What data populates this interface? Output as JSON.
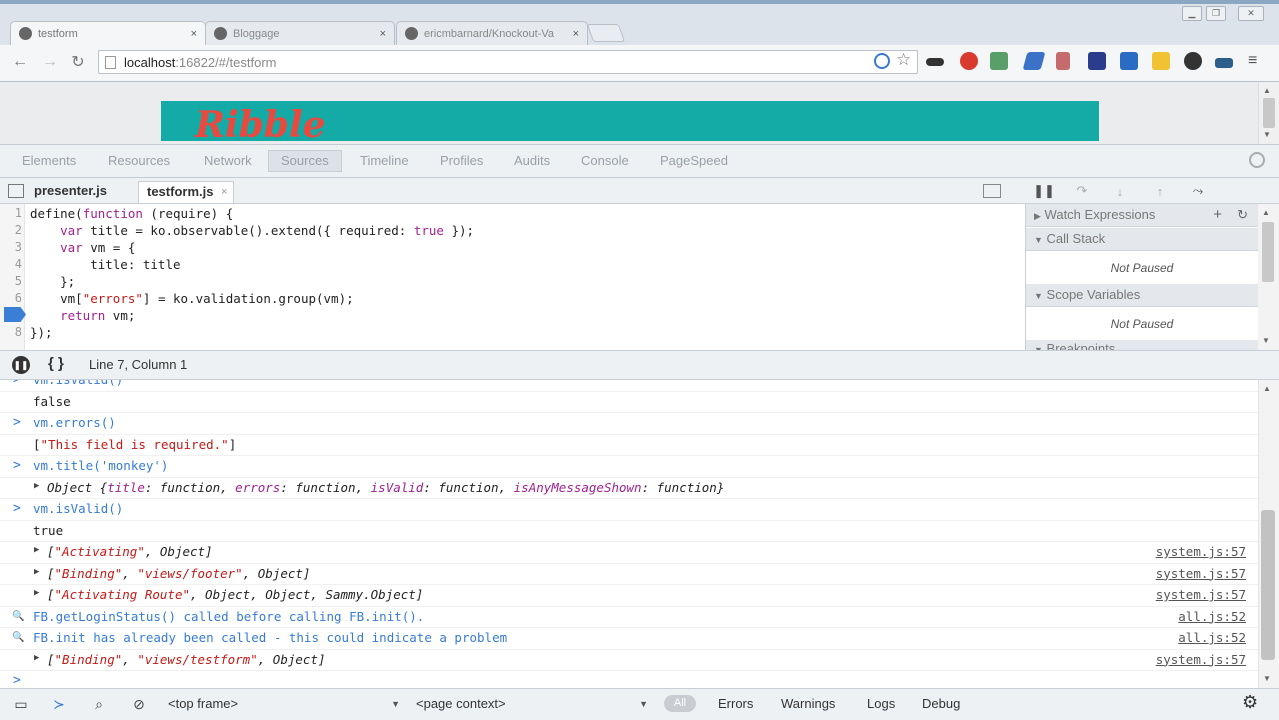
{
  "browser": {
    "tabs": [
      {
        "label": "testform",
        "close": "×"
      },
      {
        "label": "Bloggage",
        "close": "×"
      },
      {
        "label": "ericmbarnard/Knockout-Va",
        "close": "×"
      }
    ],
    "address": {
      "host": "localhost",
      "rest": ":16822/#/testform"
    }
  },
  "page": {
    "logo": "Ribble"
  },
  "devtools": {
    "tabs": [
      "Elements",
      "Resources",
      "Network",
      "Sources",
      "Timeline",
      "Profiles",
      "Audits",
      "Console",
      "PageSpeed"
    ],
    "file_tabs": [
      "presenter.js",
      "testform.js"
    ],
    "file_tab_close": "×",
    "code_lines": [
      {
        "num": "1",
        "parts": [
          [
            "",
            "define("
          ],
          [
            "kw",
            "function"
          ],
          [
            "",
            " (require) {"
          ]
        ]
      },
      {
        "num": "2",
        "parts": [
          [
            "",
            "    "
          ],
          [
            "kw",
            "var"
          ],
          [
            "",
            " title = ko.observable().extend({ required: "
          ],
          [
            "kw",
            "true"
          ],
          [
            "",
            " });"
          ]
        ]
      },
      {
        "num": "3",
        "parts": [
          [
            "",
            "    "
          ],
          [
            "kw",
            "var"
          ],
          [
            "",
            " vm = {"
          ]
        ]
      },
      {
        "num": "4",
        "parts": [
          [
            "",
            "        title: title"
          ]
        ]
      },
      {
        "num": "5",
        "parts": [
          [
            "",
            "    };"
          ]
        ]
      },
      {
        "num": "6",
        "parts": [
          [
            "",
            "    vm["
          ],
          [
            "str",
            "\"errors\""
          ],
          [
            "",
            "] = ko.validation.group(vm);"
          ]
        ]
      },
      {
        "num": "7",
        "parts": [
          [
            "",
            "    "
          ],
          [
            "kw",
            "return"
          ],
          [
            "",
            " vm;"
          ]
        ]
      },
      {
        "num": "8",
        "parts": [
          [
            "",
            "});"
          ]
        ]
      }
    ],
    "sidebar": {
      "watch": "Watch Expressions",
      "call_stack": "Call Stack",
      "call_stack_status": "Not Paused",
      "scope": "Scope Variables",
      "scope_status": "Not Paused",
      "breakpoints": "Breakpoints"
    },
    "status_position": "Line 7, Column 1",
    "console_lines": [
      {
        "kind": "input",
        "prompt": ">",
        "parts": [
          [
            "blue",
            "vm.isValid()"
          ]
        ],
        "src": ""
      },
      {
        "kind": "output",
        "prompt": "",
        "parts": [
          [
            "dark",
            "false"
          ]
        ],
        "src": ""
      },
      {
        "kind": "input",
        "prompt": ">",
        "parts": [
          [
            "blue",
            "vm.errors()"
          ]
        ],
        "src": ""
      },
      {
        "kind": "output",
        "prompt": "",
        "parts": [
          [
            "dark",
            "["
          ],
          [
            "red",
            "\"This field is required.\""
          ],
          [
            "dark",
            "]"
          ]
        ],
        "src": ""
      },
      {
        "kind": "input",
        "prompt": ">",
        "parts": [
          [
            "blue",
            "vm.title('monkey')"
          ]
        ],
        "src": ""
      },
      {
        "kind": "object",
        "prompt": "",
        "parts": [
          [
            "it",
            "Object {"
          ],
          [
            "itk",
            "title"
          ],
          [
            "it",
            ": function, "
          ],
          [
            "itk",
            "errors"
          ],
          [
            "it",
            ": function, "
          ],
          [
            "itk",
            "isValid"
          ],
          [
            "it",
            ": function, "
          ],
          [
            "itk",
            "isAnyMessageShown"
          ],
          [
            "it",
            ": function}"
          ]
        ],
        "src": ""
      },
      {
        "kind": "input",
        "prompt": ">",
        "parts": [
          [
            "blue",
            "vm.isValid()"
          ]
        ],
        "src": ""
      },
      {
        "kind": "output",
        "prompt": "",
        "parts": [
          [
            "dark",
            "true"
          ]
        ],
        "src": ""
      },
      {
        "kind": "object",
        "prompt": "",
        "parts": [
          [
            "it",
            "["
          ],
          [
            "istr",
            "\"Activating\""
          ],
          [
            "it",
            ", Object]"
          ]
        ],
        "src": "system.js:57"
      },
      {
        "kind": "object",
        "prompt": "",
        "parts": [
          [
            "it",
            "["
          ],
          [
            "istr",
            "\"Binding\""
          ],
          [
            "it",
            ", "
          ],
          [
            "istr",
            "\"views/footer\""
          ],
          [
            "it",
            ", Object]"
          ]
        ],
        "src": "system.js:57"
      },
      {
        "kind": "object",
        "prompt": "",
        "parts": [
          [
            "it",
            "["
          ],
          [
            "istr",
            "\"Activating Route\""
          ],
          [
            "it",
            ", Object, Object, Sammy.Object]"
          ]
        ],
        "src": "system.js:57"
      },
      {
        "kind": "info",
        "prompt": "🔍",
        "parts": [
          [
            "blue",
            "FB.getLoginStatus() called before calling FB.init()."
          ]
        ],
        "src": "all.js:52"
      },
      {
        "kind": "info",
        "prompt": "🔍",
        "parts": [
          [
            "blue",
            "FB.init has already been called - this could indicate a problem"
          ]
        ],
        "src": "all.js:52"
      },
      {
        "kind": "object",
        "prompt": "",
        "parts": [
          [
            "it",
            "["
          ],
          [
            "istr",
            "\"Binding\""
          ],
          [
            "it",
            ", "
          ],
          [
            "istr",
            "\"views/testform\""
          ],
          [
            "it",
            ", Object]"
          ]
        ],
        "src": "system.js:57"
      },
      {
        "kind": "input",
        "prompt": ">",
        "parts": [],
        "src": ""
      }
    ],
    "bottom": {
      "frame": "<top frame>",
      "context": "<page context>",
      "all": "All",
      "filters": [
        "Errors",
        "Warnings",
        "Logs",
        "Debug"
      ]
    }
  },
  "colors": {
    "banner": "#14aaa5",
    "logo": "#e84a3f",
    "breakpoint": "#3a7fd5"
  }
}
